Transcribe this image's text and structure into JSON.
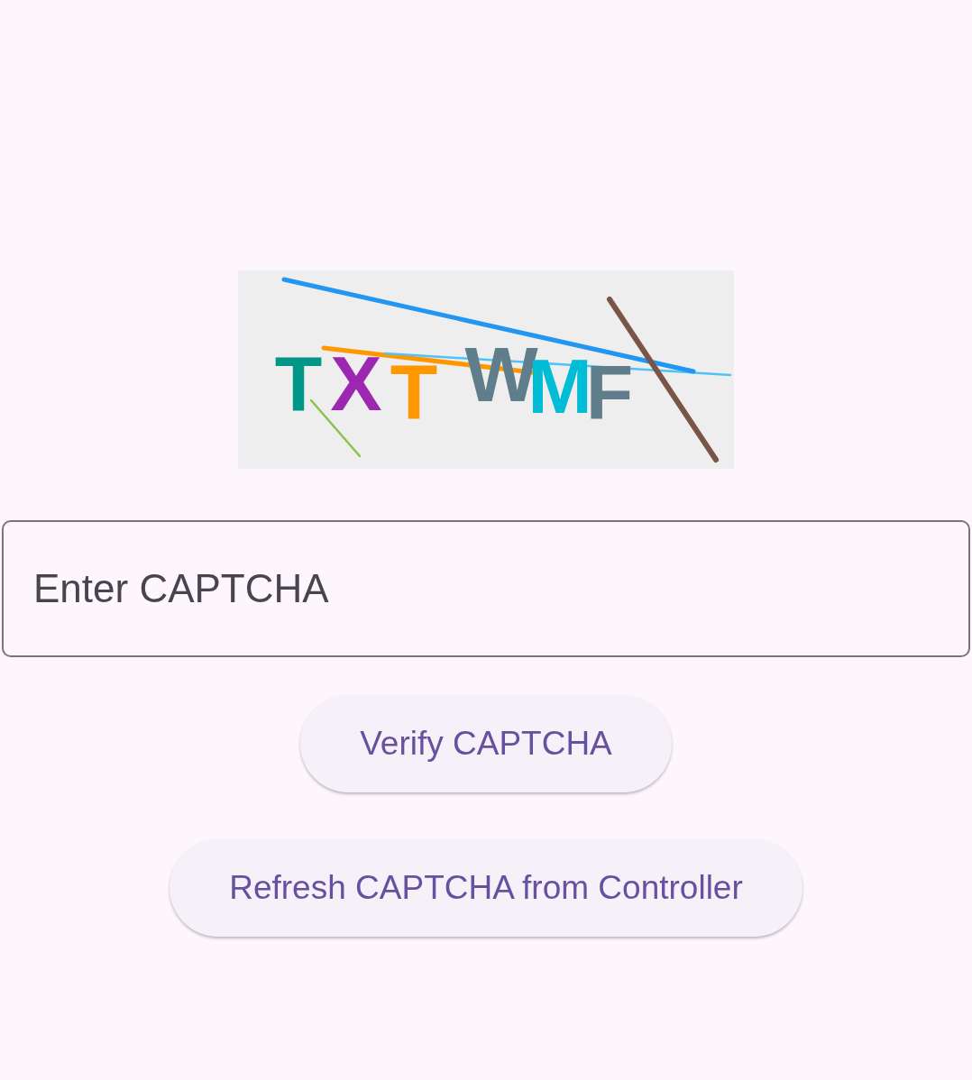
{
  "captcha": {
    "characters": [
      {
        "text": "T",
        "color": "#009688"
      },
      {
        "text": "X",
        "color": "#9c27b0"
      },
      {
        "text": "T",
        "color": "#ff9800"
      },
      {
        "text": "W",
        "color": "#607d8b"
      },
      {
        "text": "M",
        "color": "#00bcd4"
      },
      {
        "text": "F",
        "color": "#607d8b"
      }
    ]
  },
  "captcha_input": {
    "placeholder": "Enter CAPTCHA"
  },
  "buttons": [
    {
      "label": "Verify CAPTCHA"
    },
    {
      "label": "Refresh CAPTCHA from Controller"
    }
  ]
}
